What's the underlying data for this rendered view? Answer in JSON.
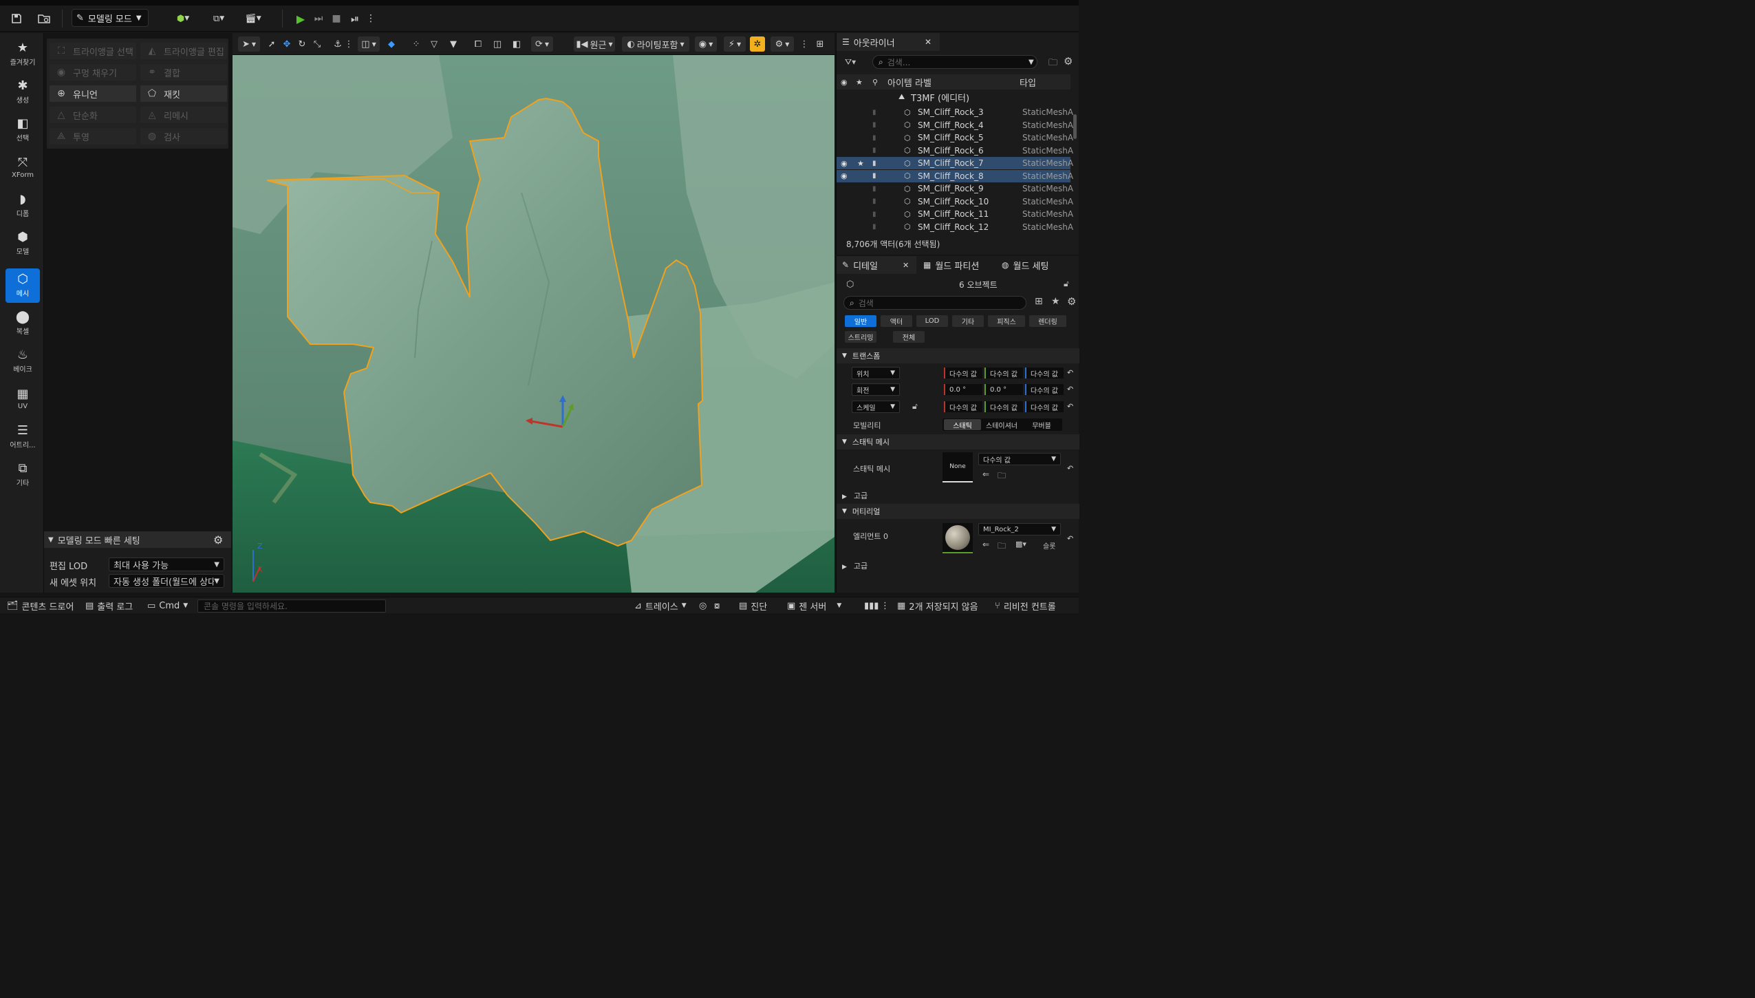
{
  "toolbar": {
    "mode_label": "모델링 모드",
    "save_icon": "save-icon",
    "browse_icon": "folder-icon",
    "play_icon": "play-icon"
  },
  "left_rail": {
    "items": [
      {
        "label": "즐겨찾기",
        "icon": "★"
      },
      {
        "label": "생성",
        "icon": "✱"
      },
      {
        "label": "선택",
        "icon": "◧"
      },
      {
        "label": "XForm",
        "icon": "⤧"
      },
      {
        "label": "디폼",
        "icon": "◗"
      },
      {
        "label": "모델",
        "icon": "⬢"
      },
      {
        "label": "메시",
        "icon": "⬡"
      },
      {
        "label": "복셀",
        "icon": "⬤"
      },
      {
        "label": "베이크",
        "icon": "♨"
      },
      {
        "label": "UV",
        "icon": "▦"
      },
      {
        "label": "어트리...",
        "icon": "☰"
      },
      {
        "label": "기타",
        "icon": "⧉"
      }
    ],
    "active_index": 6
  },
  "tools": {
    "items": [
      {
        "label": "트라이앵글 선택",
        "icon": "⛶",
        "enabled": false
      },
      {
        "label": "트라이앵글 편집",
        "icon": "◭",
        "enabled": false
      },
      {
        "label": "구멍 채우기",
        "icon": "◉",
        "enabled": false
      },
      {
        "label": "결합",
        "icon": "⚭",
        "enabled": false
      },
      {
        "label": "유니언",
        "icon": "⊕",
        "enabled": true
      },
      {
        "label": "재킷",
        "icon": "⬠",
        "enabled": true
      },
      {
        "label": "단순화",
        "icon": "△",
        "enabled": false
      },
      {
        "label": "리메시",
        "icon": "◬",
        "enabled": false
      },
      {
        "label": "투영",
        "icon": "⟁",
        "enabled": false
      },
      {
        "label": "검사",
        "icon": "◍",
        "enabled": false
      }
    ]
  },
  "quick_settings": {
    "title": "모델링 모드 빠른 세팅",
    "edit_lod_label": "편집 LOD",
    "edit_lod_value": "최대 사용 가능",
    "new_asset_label": "새 에셋 위치",
    "new_asset_value": "자동 생성 폴더(월드에 상대"
  },
  "viewport": {
    "perspective": "원근",
    "lighting": "라이팅포함",
    "accent_color": "#f2b01e"
  },
  "outliner": {
    "tab_title": "아웃라이너",
    "search_placeholder": "검색...",
    "col_label": "아이템 라벨",
    "col_type": "타입",
    "root": "T3MF (에디터)",
    "rows": [
      {
        "name": "SM_Cliff_Rock_3",
        "type": "StaticMeshA",
        "selected": false
      },
      {
        "name": "SM_Cliff_Rock_4",
        "type": "StaticMeshA",
        "selected": false
      },
      {
        "name": "SM_Cliff_Rock_5",
        "type": "StaticMeshA",
        "selected": false
      },
      {
        "name": "SM_Cliff_Rock_6",
        "type": "StaticMeshA",
        "selected": false
      },
      {
        "name": "SM_Cliff_Rock_7",
        "type": "StaticMeshA",
        "selected": true
      },
      {
        "name": "SM_Cliff_Rock_8",
        "type": "StaticMeshA",
        "selected": true
      },
      {
        "name": "SM_Cliff_Rock_9",
        "type": "StaticMeshA",
        "selected": false
      },
      {
        "name": "SM_Cliff_Rock_10",
        "type": "StaticMeshA",
        "selected": false
      },
      {
        "name": "SM_Cliff_Rock_11",
        "type": "StaticMeshA",
        "selected": false
      },
      {
        "name": "SM_Cliff_Rock_12",
        "type": "StaticMeshA",
        "selected": false
      }
    ],
    "status": "8,706개 액터(6개 선택됨)"
  },
  "details": {
    "tabs": [
      "디테일",
      "월드 파티션",
      "월드 세팅"
    ],
    "object_count": "6 오브젝트",
    "search_placeholder": "검색",
    "filter_chips": [
      "일반",
      "액터",
      "LOD",
      "기타",
      "피직스",
      "렌더링",
      "스트리밍",
      "전체"
    ],
    "transform_title": "트랜스폼",
    "location_label": "위치",
    "rotation_label": "회전",
    "scale_label": "스케일",
    "multi_value": "다수의 값",
    "rot_x": "0.0 °",
    "rot_y": "0.0 °",
    "mobility_label": "모빌리티",
    "mobility_options": [
      "스태틱",
      "스테이셔너",
      "무버블"
    ],
    "static_mesh_title": "스태틱 메시",
    "static_mesh_label": "스태틱 메시",
    "static_mesh_thumb": "None",
    "advanced": "고급",
    "material_title": "머티리얼",
    "element_label": "엘리먼트 0",
    "material_value": "MI_Rock_2",
    "source_label": "슬롯"
  },
  "statusbar": {
    "content_drawer": "콘텐츠 드로어",
    "output_log": "출력 로그",
    "cmd": "Cmd",
    "console_placeholder": "콘솔 명령을 입력하세요.",
    "trace": "트레이스",
    "diagnostics": "진단",
    "zen_server": "젠 서버",
    "unsaved": "2개 저장되지 않음",
    "revision": "리비전 컨트롤"
  }
}
